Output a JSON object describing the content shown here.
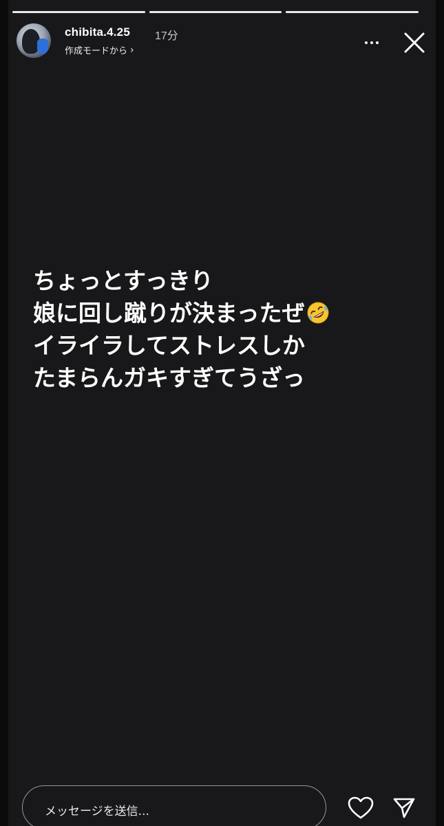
{
  "story": {
    "progress_segments": [
      1.0,
      1.0,
      1.0
    ],
    "header": {
      "username": "chibita.4.25",
      "timestamp": "17分",
      "subline": "作成モードから",
      "subline_chevron": "chevron-right-icon",
      "more_icon": "more-horizontal-icon",
      "close_icon": "close-icon"
    },
    "caption": {
      "line1": "ちょっとすっきり",
      "line2": "娘に回し蹴りが決まったぜ",
      "line2_emoji": "rolling-on-floor-laughing-emoji",
      "line3": "イライラしてストレスしか",
      "line4": "たまらんガキすぎてうざっ"
    },
    "footer": {
      "message_placeholder": "メッセージを送信...",
      "heart_icon": "heart-icon",
      "share_icon": "send-icon"
    }
  },
  "colors": {
    "background": "#18181a",
    "text": "#ffffff",
    "muted": "#c9c9cc"
  }
}
